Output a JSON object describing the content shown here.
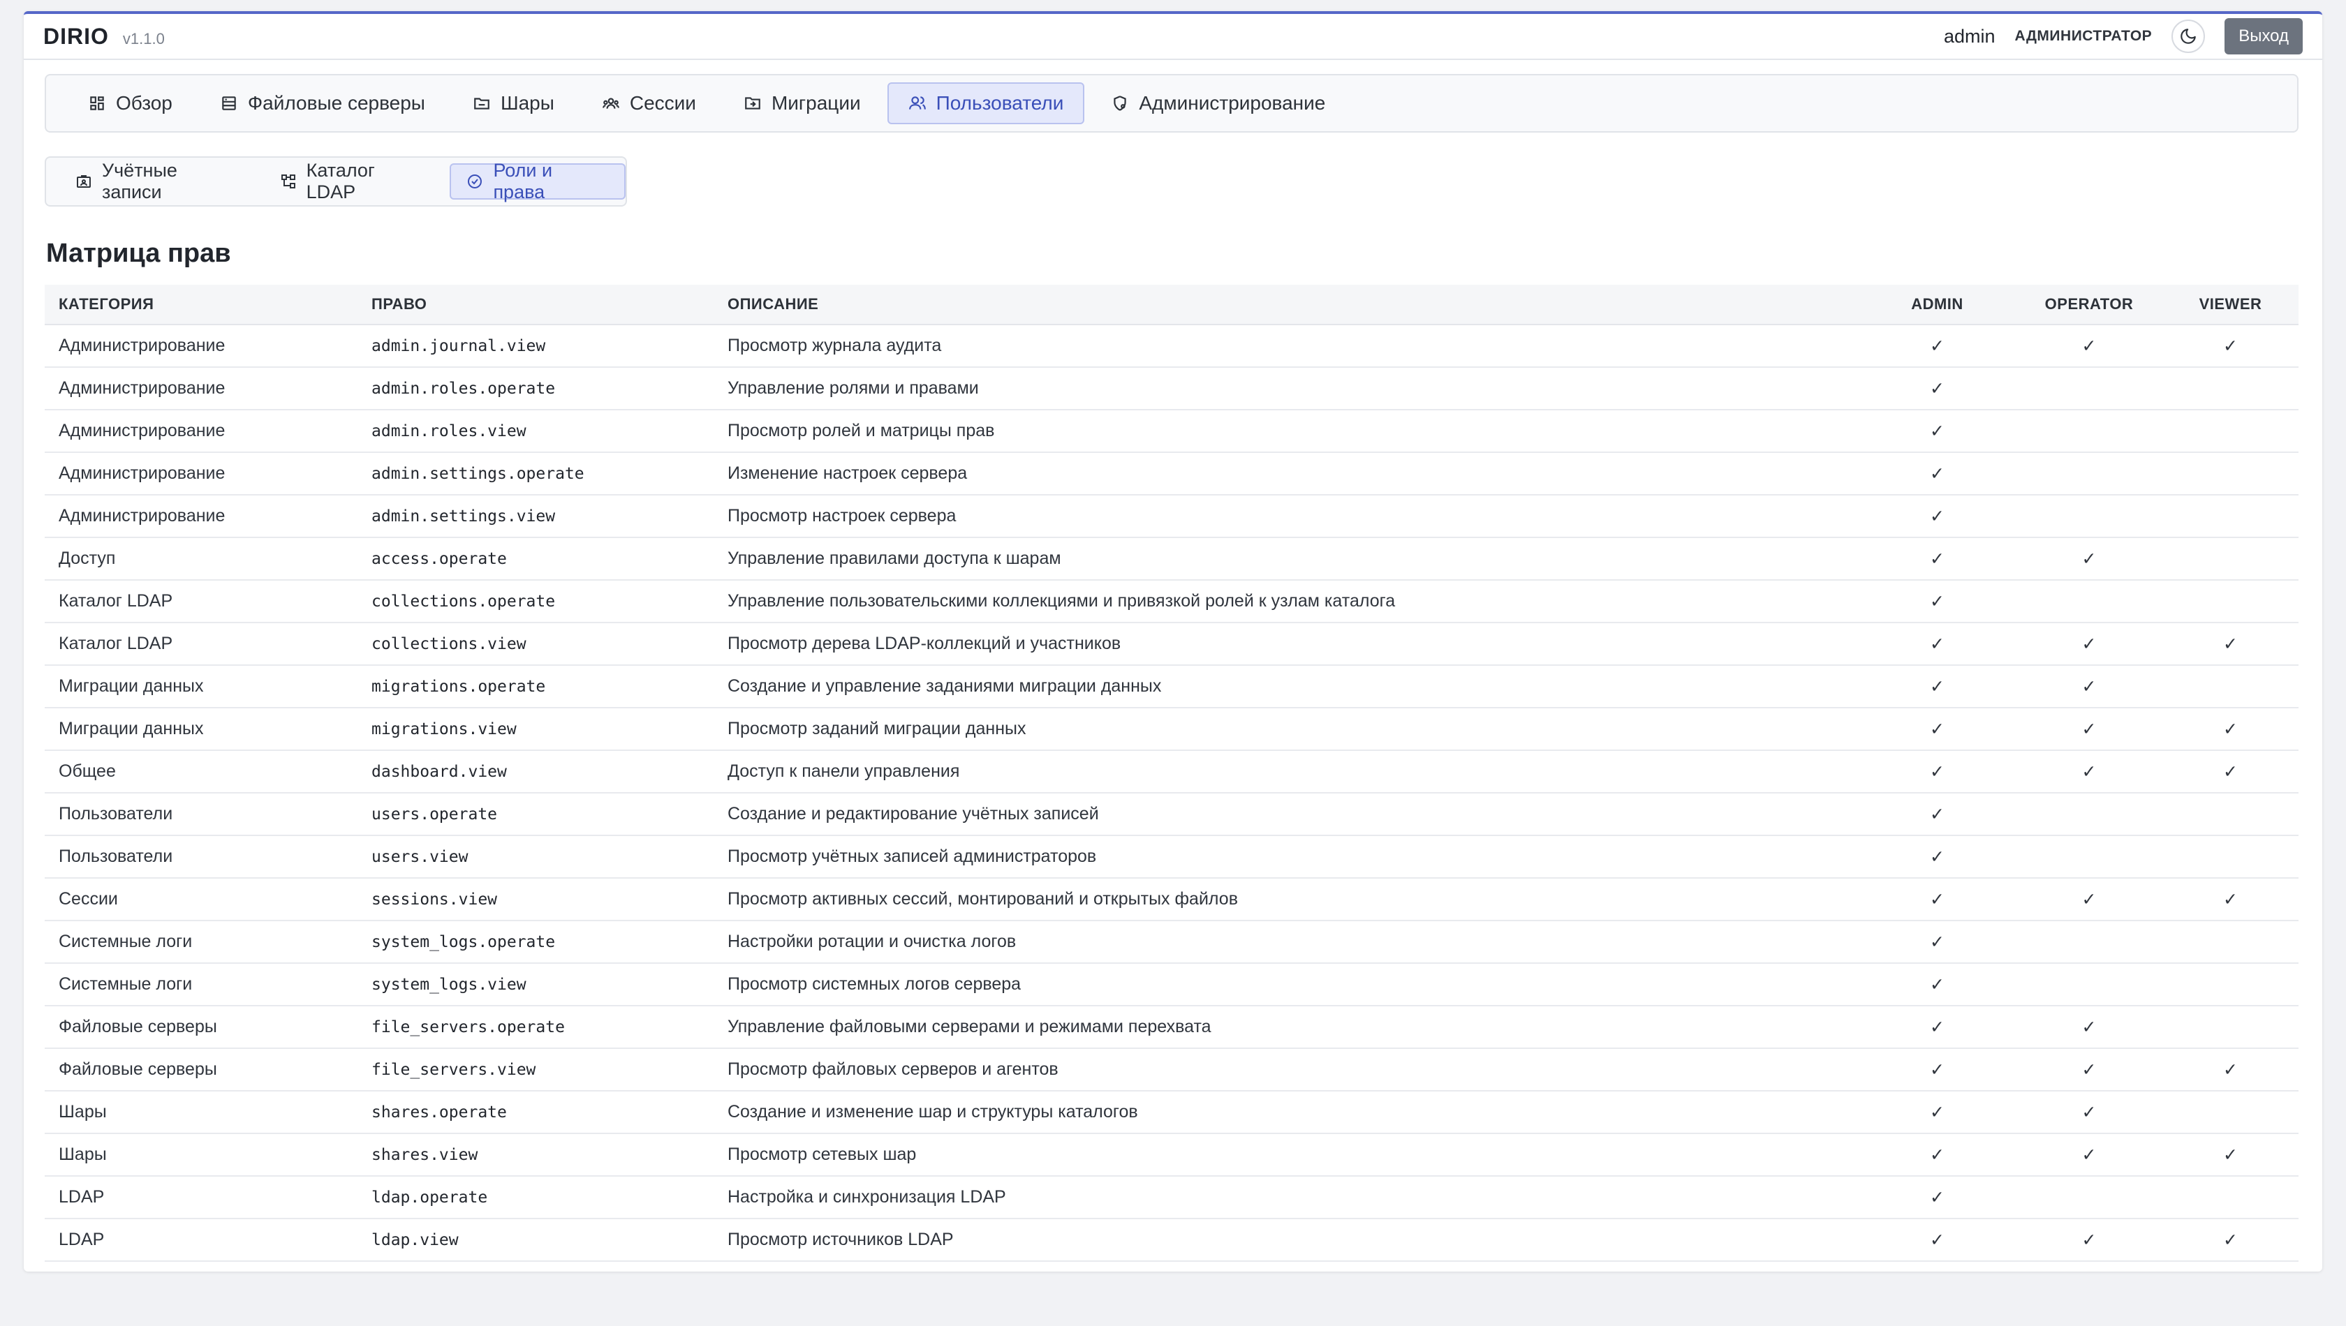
{
  "header": {
    "brand": "DIRIO",
    "version": "v1.1.0",
    "user_name": "admin",
    "user_role": "АДМИНИСТРАТОР",
    "logout_label": "Выход"
  },
  "main_nav": [
    {
      "label": "Обзор",
      "icon": "dashboard-icon",
      "active": false
    },
    {
      "label": "Файловые серверы",
      "icon": "server-icon",
      "active": false
    },
    {
      "label": "Шары",
      "icon": "folder-icon",
      "active": false
    },
    {
      "label": "Сессии",
      "icon": "users-group-icon",
      "active": false
    },
    {
      "label": "Миграции",
      "icon": "folder-arrow-icon",
      "active": false
    },
    {
      "label": "Пользователи",
      "icon": "users-icon",
      "active": true
    },
    {
      "label": "Администрирование",
      "icon": "settings-shield-icon",
      "active": false
    }
  ],
  "sub_nav": [
    {
      "label": "Учётные записи",
      "icon": "id-card-icon",
      "active": false
    },
    {
      "label": "Каталог LDAP",
      "icon": "tree-icon",
      "active": false
    },
    {
      "label": "Роли и права",
      "icon": "check-circle-icon",
      "active": true
    }
  ],
  "page_title": "Матрица прав",
  "table": {
    "columns": {
      "category": "КАТЕГОРИЯ",
      "permission": "ПРАВО",
      "description": "ОПИСАНИЕ",
      "admin": "ADMIN",
      "operator": "OPERATOR",
      "viewer": "VIEWER"
    },
    "check_mark": "✓",
    "rows": [
      {
        "category": "Администрирование",
        "permission": "admin.journal.view",
        "description": "Просмотр журнала аудита",
        "admin": true,
        "operator": true,
        "viewer": true
      },
      {
        "category": "Администрирование",
        "permission": "admin.roles.operate",
        "description": "Управление ролями и правами",
        "admin": true,
        "operator": false,
        "viewer": false
      },
      {
        "category": "Администрирование",
        "permission": "admin.roles.view",
        "description": "Просмотр ролей и матрицы прав",
        "admin": true,
        "operator": false,
        "viewer": false
      },
      {
        "category": "Администрирование",
        "permission": "admin.settings.operate",
        "description": "Изменение настроек сервера",
        "admin": true,
        "operator": false,
        "viewer": false
      },
      {
        "category": "Администрирование",
        "permission": "admin.settings.view",
        "description": "Просмотр настроек сервера",
        "admin": true,
        "operator": false,
        "viewer": false
      },
      {
        "category": "Доступ",
        "permission": "access.operate",
        "description": "Управление правилами доступа к шарам",
        "admin": true,
        "operator": true,
        "viewer": false
      },
      {
        "category": "Каталог LDAP",
        "permission": "collections.operate",
        "description": "Управление пользовательскими коллекциями и привязкой ролей к узлам каталога",
        "admin": true,
        "operator": false,
        "viewer": false
      },
      {
        "category": "Каталог LDAP",
        "permission": "collections.view",
        "description": "Просмотр дерева LDAP-коллекций и участников",
        "admin": true,
        "operator": true,
        "viewer": true
      },
      {
        "category": "Миграции данных",
        "permission": "migrations.operate",
        "description": "Создание и управление заданиями миграции данных",
        "admin": true,
        "operator": true,
        "viewer": false
      },
      {
        "category": "Миграции данных",
        "permission": "migrations.view",
        "description": "Просмотр заданий миграции данных",
        "admin": true,
        "operator": true,
        "viewer": true
      },
      {
        "category": "Общее",
        "permission": "dashboard.view",
        "description": "Доступ к панели управления",
        "admin": true,
        "operator": true,
        "viewer": true
      },
      {
        "category": "Пользователи",
        "permission": "users.operate",
        "description": "Создание и редактирование учётных записей",
        "admin": true,
        "operator": false,
        "viewer": false
      },
      {
        "category": "Пользователи",
        "permission": "users.view",
        "description": "Просмотр учётных записей администраторов",
        "admin": true,
        "operator": false,
        "viewer": false
      },
      {
        "category": "Сессии",
        "permission": "sessions.view",
        "description": "Просмотр активных сессий, монтирований и открытых файлов",
        "admin": true,
        "operator": true,
        "viewer": true
      },
      {
        "category": "Системные логи",
        "permission": "system_logs.operate",
        "description": "Настройки ротации и очистка логов",
        "admin": true,
        "operator": false,
        "viewer": false
      },
      {
        "category": "Системные логи",
        "permission": "system_logs.view",
        "description": "Просмотр системных логов сервера",
        "admin": true,
        "operator": false,
        "viewer": false
      },
      {
        "category": "Файловые серверы",
        "permission": "file_servers.operate",
        "description": "Управление файловыми серверами и режимами перехвата",
        "admin": true,
        "operator": true,
        "viewer": false
      },
      {
        "category": "Файловые серверы",
        "permission": "file_servers.view",
        "description": "Просмотр файловых серверов и агентов",
        "admin": true,
        "operator": true,
        "viewer": true
      },
      {
        "category": "Шары",
        "permission": "shares.operate",
        "description": "Создание и изменение шар и структуры каталогов",
        "admin": true,
        "operator": true,
        "viewer": false
      },
      {
        "category": "Шары",
        "permission": "shares.view",
        "description": "Просмотр сетевых шар",
        "admin": true,
        "operator": true,
        "viewer": true
      },
      {
        "category": "LDAP",
        "permission": "ldap.operate",
        "description": "Настройка и синхронизация LDAP",
        "admin": true,
        "operator": false,
        "viewer": false
      },
      {
        "category": "LDAP",
        "permission": "ldap.view",
        "description": "Просмотр источников LDAP",
        "admin": true,
        "operator": true,
        "viewer": true
      }
    ]
  }
}
